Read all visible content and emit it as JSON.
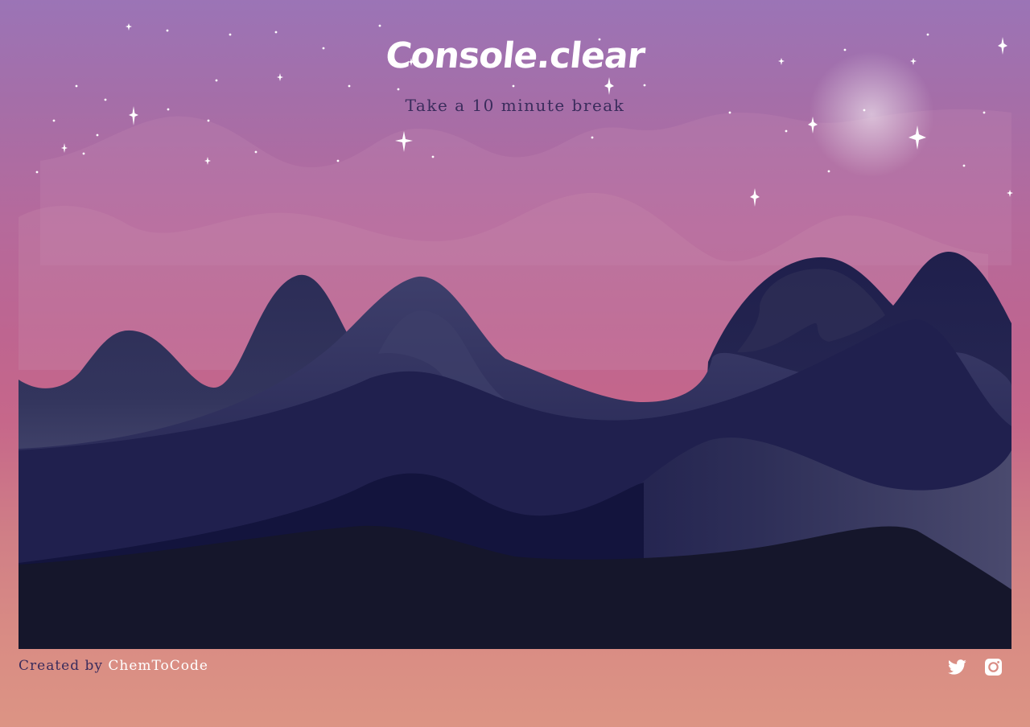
{
  "header": {
    "title": "Console.clear",
    "subtitle": "Take a 10 minute break"
  },
  "footer": {
    "created_by_label": "Created by",
    "author_link": "ChemToCode"
  },
  "social": {
    "twitter_icon": "twitter-icon",
    "instagram_icon": "instagram-icon"
  },
  "colors": {
    "sky_top": "#9b74b6",
    "sky_mid": "#be6590",
    "sky_bottom": "#dc9484",
    "mountain_far": "#313258",
    "mountain_mid": "#20204e",
    "mountain_deep": "#13143d",
    "ground": "#15162b",
    "text_dark": "#3a2c5c",
    "text_light": "#ffffff"
  }
}
